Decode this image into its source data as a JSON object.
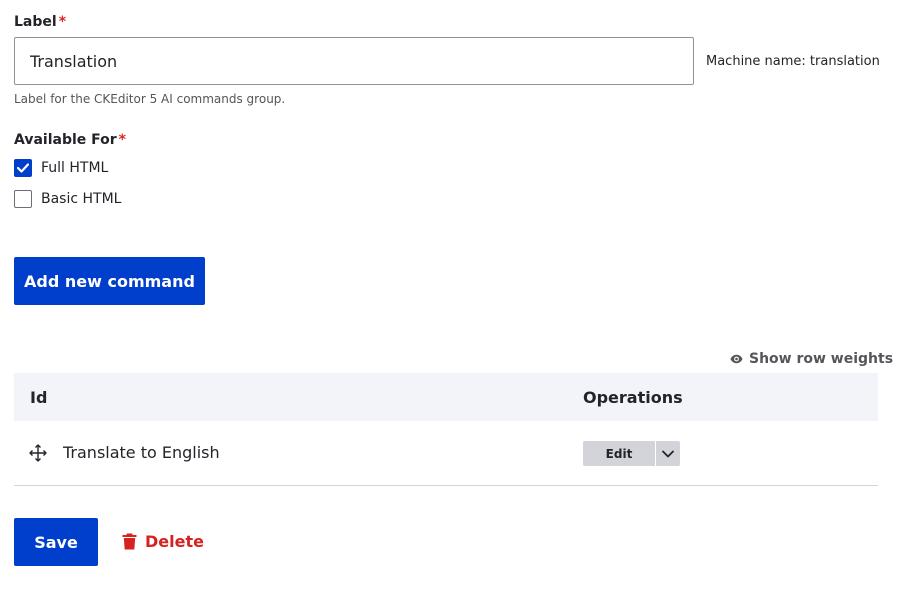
{
  "label_field": {
    "label": "Label",
    "required_mark": "*",
    "value": "Translation",
    "machine_name": "Machine name: translation",
    "help": "Label for the CKEditor 5 AI commands group."
  },
  "available_for": {
    "legend": "Available For",
    "required_mark": "*",
    "options": [
      {
        "label": "Full HTML",
        "checked": true
      },
      {
        "label": "Basic HTML",
        "checked": false
      }
    ]
  },
  "add_command_label": "Add new command",
  "show_row_weights_label": "Show row weights",
  "table": {
    "headers": [
      "Id",
      "Operations"
    ],
    "rows": [
      {
        "label": "Translate to English",
        "operation": "Edit"
      }
    ]
  },
  "actions": {
    "save_label": "Save",
    "delete_label": "Delete"
  },
  "colors": {
    "primary": "#003ecc",
    "danger": "#d72222",
    "required": "#dc2323"
  }
}
